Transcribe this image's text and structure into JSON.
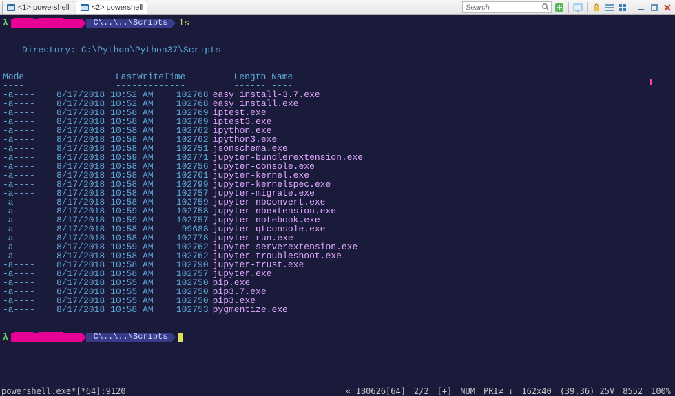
{
  "tabs": [
    {
      "label": "<1> powershell",
      "active": false
    },
    {
      "label": "<2> powershell",
      "active": true
    }
  ],
  "search": {
    "placeholder": "Search"
  },
  "prompt": {
    "user_seg": "████@█████-PC",
    "path_seg": "C\\..\\..\\Scripts",
    "command": "ls"
  },
  "directory_line": "Directory: C:\\Python\\Python37\\Scripts",
  "headers": {
    "mode": "Mode",
    "lastwrite": "LastWriteTime",
    "length": "Length",
    "name": "Name"
  },
  "header_dashes": {
    "mode": "----",
    "lastwrite": "-------------",
    "length": "------",
    "name": "----"
  },
  "rows": [
    {
      "mode": "-a----",
      "date": "8/17/2018",
      "time": "10:52 AM",
      "length": "102768",
      "name": "easy_install-3.7.exe"
    },
    {
      "mode": "-a----",
      "date": "8/17/2018",
      "time": "10:52 AM",
      "length": "102768",
      "name": "easy_install.exe"
    },
    {
      "mode": "-a----",
      "date": "8/17/2018",
      "time": "10:58 AM",
      "length": "102769",
      "name": "iptest.exe"
    },
    {
      "mode": "-a----",
      "date": "8/17/2018",
      "time": "10:58 AM",
      "length": "102769",
      "name": "iptest3.exe"
    },
    {
      "mode": "-a----",
      "date": "8/17/2018",
      "time": "10:58 AM",
      "length": "102762",
      "name": "ipython.exe"
    },
    {
      "mode": "-a----",
      "date": "8/17/2018",
      "time": "10:58 AM",
      "length": "102762",
      "name": "ipython3.exe"
    },
    {
      "mode": "-a----",
      "date": "8/17/2018",
      "time": "10:58 AM",
      "length": "102751",
      "name": "jsonschema.exe"
    },
    {
      "mode": "-a----",
      "date": "8/17/2018",
      "time": "10:59 AM",
      "length": "102771",
      "name": "jupyter-bundlerextension.exe"
    },
    {
      "mode": "-a----",
      "date": "8/17/2018",
      "time": "10:58 AM",
      "length": "102756",
      "name": "jupyter-console.exe"
    },
    {
      "mode": "-a----",
      "date": "8/17/2018",
      "time": "10:58 AM",
      "length": "102761",
      "name": "jupyter-kernel.exe"
    },
    {
      "mode": "-a----",
      "date": "8/17/2018",
      "time": "10:58 AM",
      "length": "102799",
      "name": "jupyter-kernelspec.exe"
    },
    {
      "mode": "-a----",
      "date": "8/17/2018",
      "time": "10:58 AM",
      "length": "102757",
      "name": "jupyter-migrate.exe"
    },
    {
      "mode": "-a----",
      "date": "8/17/2018",
      "time": "10:58 AM",
      "length": "102759",
      "name": "jupyter-nbconvert.exe"
    },
    {
      "mode": "-a----",
      "date": "8/17/2018",
      "time": "10:59 AM",
      "length": "102758",
      "name": "jupyter-nbextension.exe"
    },
    {
      "mode": "-a----",
      "date": "8/17/2018",
      "time": "10:59 AM",
      "length": "102757",
      "name": "jupyter-notebook.exe"
    },
    {
      "mode": "-a----",
      "date": "8/17/2018",
      "time": "10:58 AM",
      "length": "99688",
      "name": "jupyter-qtconsole.exe"
    },
    {
      "mode": "-a----",
      "date": "8/17/2018",
      "time": "10:58 AM",
      "length": "102778",
      "name": "jupyter-run.exe"
    },
    {
      "mode": "-a----",
      "date": "8/17/2018",
      "time": "10:59 AM",
      "length": "102762",
      "name": "jupyter-serverextension.exe"
    },
    {
      "mode": "-a----",
      "date": "8/17/2018",
      "time": "10:58 AM",
      "length": "102762",
      "name": "jupyter-troubleshoot.exe"
    },
    {
      "mode": "-a----",
      "date": "8/17/2018",
      "time": "10:58 AM",
      "length": "102790",
      "name": "jupyter-trust.exe"
    },
    {
      "mode": "-a----",
      "date": "8/17/2018",
      "time": "10:58 AM",
      "length": "102757",
      "name": "jupyter.exe"
    },
    {
      "mode": "-a----",
      "date": "8/17/2018",
      "time": "10:55 AM",
      "length": "102750",
      "name": "pip.exe"
    },
    {
      "mode": "-a----",
      "date": "8/17/2018",
      "time": "10:55 AM",
      "length": "102750",
      "name": "pip3.7.exe"
    },
    {
      "mode": "-a----",
      "date": "8/17/2018",
      "time": "10:55 AM",
      "length": "102750",
      "name": "pip3.exe"
    },
    {
      "mode": "-a----",
      "date": "8/17/2018",
      "time": "10:58 AM",
      "length": "102753",
      "name": "pygmentize.exe"
    }
  ],
  "status": {
    "left": "powershell.exe*[*64]:9120",
    "buffer": "« 180626[64]",
    "pos": "2/2",
    "flags": "[+]",
    "num": "NUM",
    "pri": "PRI≠ ↓",
    "dims": "162x40",
    "cursor": "(39,36) 25V",
    "mem": "8552",
    "pct": "100%"
  }
}
